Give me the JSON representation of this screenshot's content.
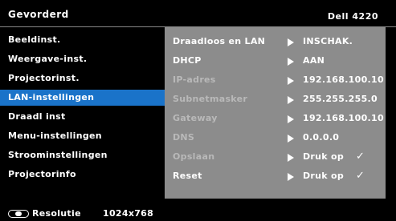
{
  "header": {
    "title": "Gevorderd",
    "model": "Dell 4220"
  },
  "menu": {
    "items": [
      {
        "label": "Beeldinst."
      },
      {
        "label": "Weergave-inst."
      },
      {
        "label": "Projectorinst."
      },
      {
        "label": "LAN-instellingen",
        "selected": true
      },
      {
        "label": "Draadl inst"
      },
      {
        "label": "Menu-instellingen"
      },
      {
        "label": "Stroominstellingen"
      },
      {
        "label": "Projectorinfo"
      }
    ]
  },
  "panel": {
    "rows": [
      {
        "label": "Draadloos en LAN",
        "value": "INSCHAK.",
        "enabled": true
      },
      {
        "label": "DHCP",
        "value": "AAN",
        "enabled": true
      },
      {
        "label": "IP-adres",
        "value": "192.168.100.10",
        "enabled": false
      },
      {
        "label": "Subnetmasker",
        "value": "255.255.255.0",
        "enabled": false
      },
      {
        "label": "Gateway",
        "value": "192.168.100.10",
        "enabled": false
      },
      {
        "label": "DNS",
        "value": "0.0.0.0",
        "enabled": false
      },
      {
        "label": "Opslaan",
        "value": "Druk op",
        "check": "✓",
        "enabled": false
      },
      {
        "label": "Reset",
        "value": "Druk op",
        "check": "✓",
        "enabled": true
      }
    ]
  },
  "footer": {
    "icon": "remote-icon",
    "label": "Resolutie",
    "resolution": "1024x768"
  },
  "colors": {
    "background": "#000000",
    "selected": "#1a73c9",
    "panel": "#8c8c8c",
    "dimmed_text": "#b9b9b9"
  }
}
